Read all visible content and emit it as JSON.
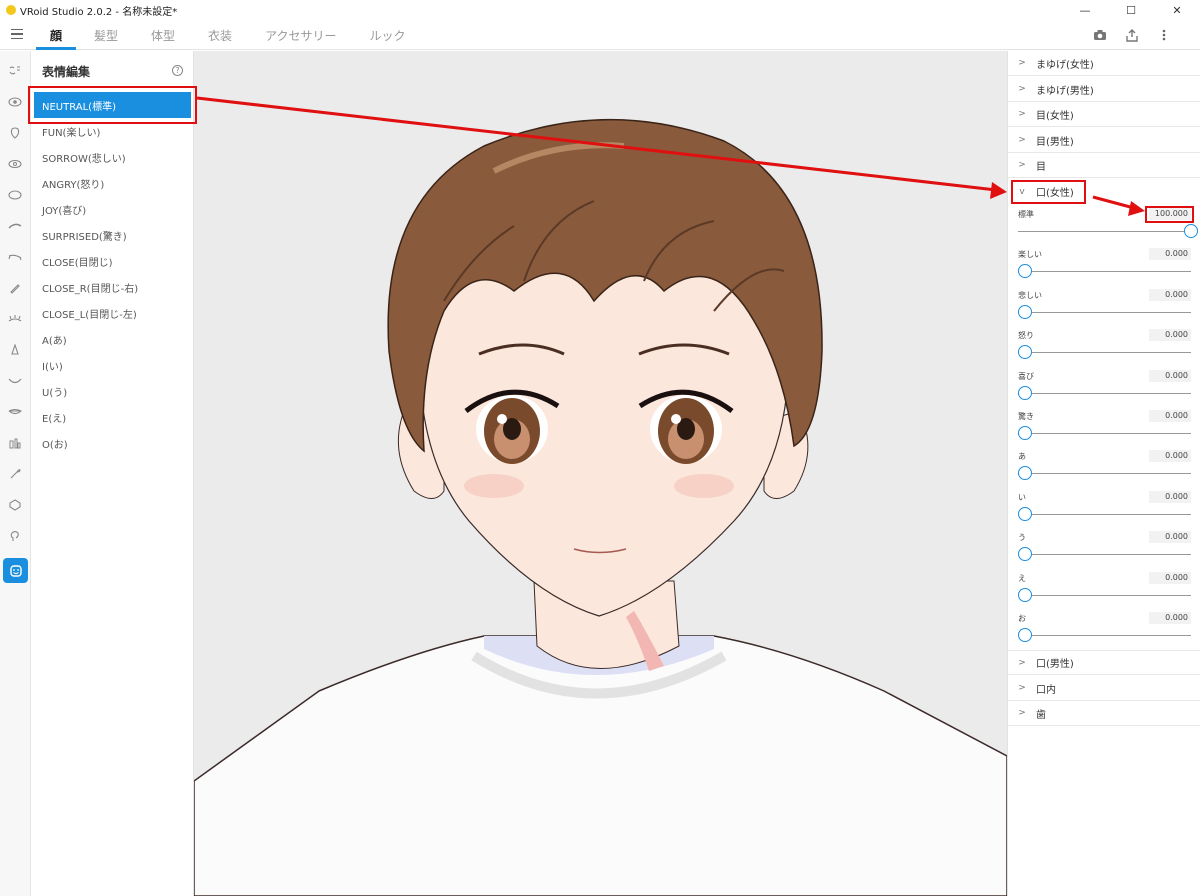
{
  "window": {
    "title": "VRoid Studio 2.0.2 - 名称未設定*",
    "minimize": "—",
    "maximize": "☐",
    "close": "✕"
  },
  "tabs": [
    {
      "label": "顔",
      "active": true
    },
    {
      "label": "髪型"
    },
    {
      "label": "体型"
    },
    {
      "label": "衣装"
    },
    {
      "label": "アクセサリー"
    },
    {
      "label": "ルック"
    }
  ],
  "toolbar_icons": [
    "camera-icon",
    "export-icon",
    "more-vertical-icon"
  ],
  "rail_icons": [
    "face-set-icon",
    "eye-icon",
    "face-shape-icon",
    "eye-alt-icon",
    "circle-icon",
    "eyebrow-icon",
    "eyelash-icon",
    "pen-icon",
    "lashes-icon",
    "nose-icon",
    "mouth-icon",
    "lips-icon",
    "ear-icon",
    "brush-icon",
    "hexagon-icon",
    "face-profile-icon",
    "expression-icon"
  ],
  "expression_panel": {
    "title": "表情編集",
    "help": "?",
    "items": [
      {
        "label": "NEUTRAL(標準)",
        "active": true
      },
      {
        "label": "FUN(楽しい)"
      },
      {
        "label": "SORROW(悲しい)"
      },
      {
        "label": "ANGRY(怒り)"
      },
      {
        "label": "JOY(喜び)"
      },
      {
        "label": "SURPRISED(驚き)"
      },
      {
        "label": "CLOSE(目閉じ)"
      },
      {
        "label": "CLOSE_R(目閉じ-右)"
      },
      {
        "label": "CLOSE_L(目閉じ-左)"
      },
      {
        "label": "A(あ)"
      },
      {
        "label": "I(い)"
      },
      {
        "label": "U(う)"
      },
      {
        "label": "E(え)"
      },
      {
        "label": "O(お)"
      }
    ]
  },
  "right_panel": {
    "sections_top": [
      {
        "label": "まゆげ(女性)",
        "chevron": ">"
      },
      {
        "label": "まゆげ(男性)",
        "chevron": ">"
      },
      {
        "label": "目(女性)",
        "chevron": ">"
      },
      {
        "label": "目(男性)",
        "chevron": ">"
      },
      {
        "label": "目",
        "chevron": ">"
      }
    ],
    "open_section": {
      "label": "口(女性)",
      "chevron": "v"
    },
    "sliders": [
      {
        "label": "標準",
        "value": "100.000",
        "fraction": 1.0
      },
      {
        "label": "楽しい",
        "value": "0.000",
        "fraction": 0
      },
      {
        "label": "悲しい",
        "value": "0.000",
        "fraction": 0
      },
      {
        "label": "怒り",
        "value": "0.000",
        "fraction": 0
      },
      {
        "label": "喜び",
        "value": "0.000",
        "fraction": 0
      },
      {
        "label": "驚き",
        "value": "0.000",
        "fraction": 0
      },
      {
        "label": "あ",
        "value": "0.000",
        "fraction": 0
      },
      {
        "label": "い",
        "value": "0.000",
        "fraction": 0
      },
      {
        "label": "う",
        "value": "0.000",
        "fraction": 0
      },
      {
        "label": "え",
        "value": "0.000",
        "fraction": 0
      },
      {
        "label": "お",
        "value": "0.000",
        "fraction": 0
      }
    ],
    "sections_bottom": [
      {
        "label": "口(男性)",
        "chevron": ">"
      },
      {
        "label": "口内",
        "chevron": ">"
      },
      {
        "label": "歯",
        "chevron": ">"
      }
    ]
  },
  "colors": {
    "accent": "#1a8fe0",
    "annotation": "#e01010"
  }
}
